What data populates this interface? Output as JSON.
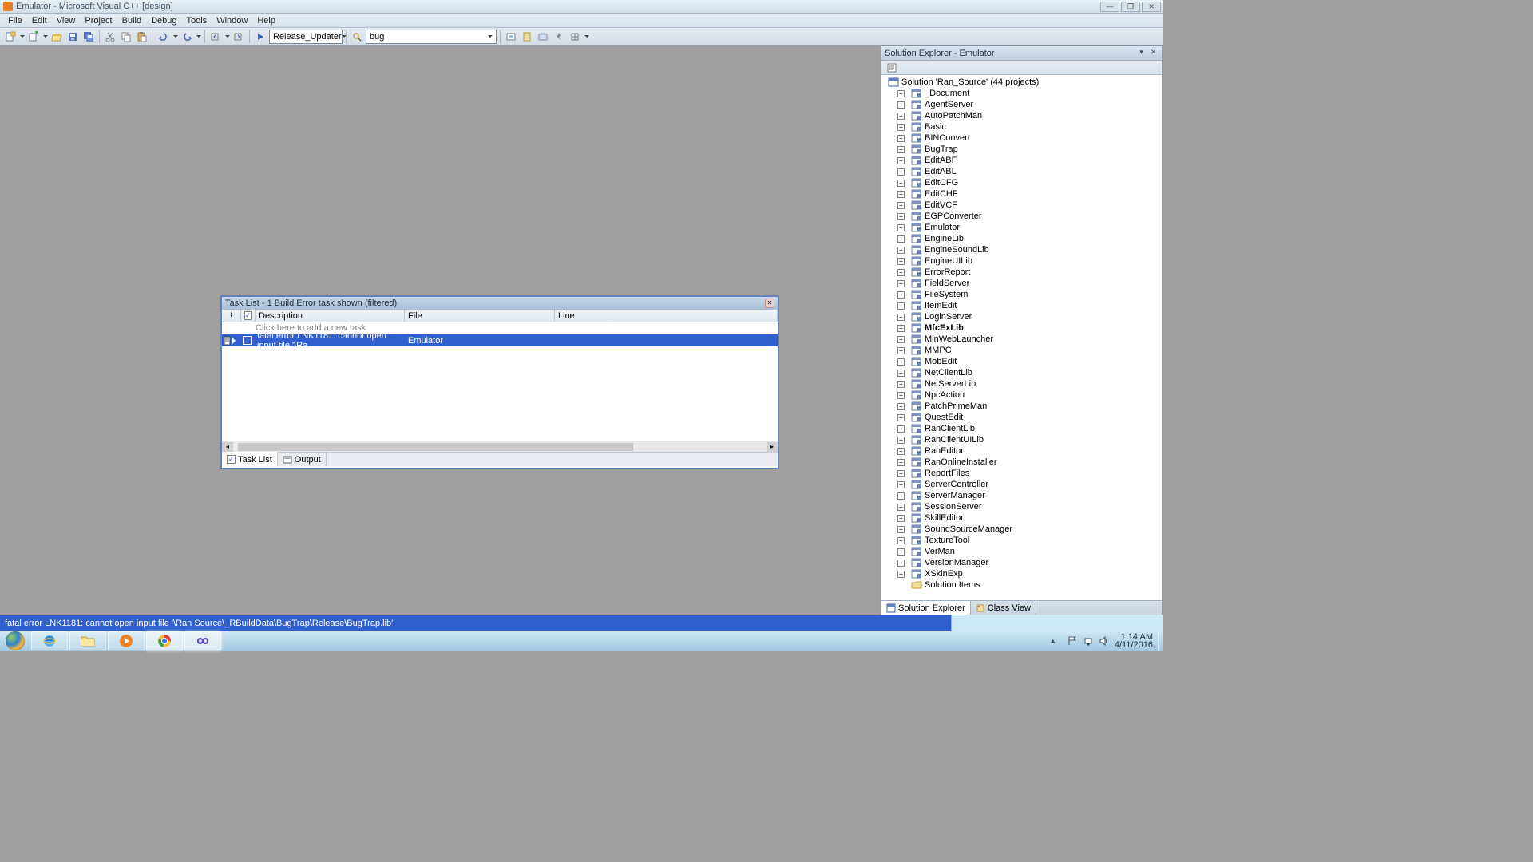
{
  "titlebar": {
    "text": "Emulator - Microsoft Visual C++ [design]"
  },
  "menu": [
    "File",
    "Edit",
    "View",
    "Project",
    "Build",
    "Debug",
    "Tools",
    "Window",
    "Help"
  ],
  "toolbar": {
    "config": "Release_Updater",
    "find": "bug"
  },
  "solexp": {
    "title": "Solution Explorer - Emulator",
    "root": "Solution 'Ran_Source' (44 projects)",
    "projects": [
      "_Document",
      "AgentServer",
      "AutoPatchMan",
      "Basic",
      "BINConvert",
      "BugTrap",
      "EditABF",
      "EditABL",
      "EditCFG",
      "EditCHF",
      "EditVCF",
      "EGPConverter",
      "Emulator",
      "EngineLib",
      "EngineSoundLib",
      "EngineUILib",
      "ErrorReport",
      "FieldServer",
      "FileSystem",
      "ItemEdit",
      "LoginServer",
      "MfcExLib",
      "MinWebLauncher",
      "MMPC",
      "MobEdit",
      "NetClientLib",
      "NetServerLib",
      "NpcAction",
      "PatchPrimeMan",
      "QuestEdit",
      "RanClientLib",
      "RanClientUILib",
      "RanEditor",
      "RanOnlineInstaller",
      "ReportFiles",
      "ServerController",
      "ServerManager",
      "SessionServer",
      "SkillEditor",
      "SoundSourceManager",
      "TextureTool",
      "VerMan",
      "VersionManager",
      "XSkinExp",
      "Solution Items"
    ],
    "bold_project": "MfcExLib",
    "tabs": {
      "active": "Solution Explorer",
      "other": "Class View"
    }
  },
  "tasklist": {
    "title": "Task List - 1 Build Error task shown (filtered)",
    "cols": {
      "bang": "!",
      "chk": "✓",
      "desc": "Description",
      "file": "File",
      "line": "Line"
    },
    "hint": "Click here to add a new task",
    "row": {
      "desc": "fatal error LNK1181: cannot open input file '\\Ra",
      "file": "Emulator"
    },
    "tabs": {
      "tasklist": "Task List",
      "output": "Output"
    }
  },
  "status": "fatal error LNK1181: cannot open input file '\\Ran Source\\_RBuildData\\BugTrap\\Release\\BugTrap.lib'",
  "tray": {
    "time": "1:14 AM",
    "date": "4/11/2016"
  }
}
